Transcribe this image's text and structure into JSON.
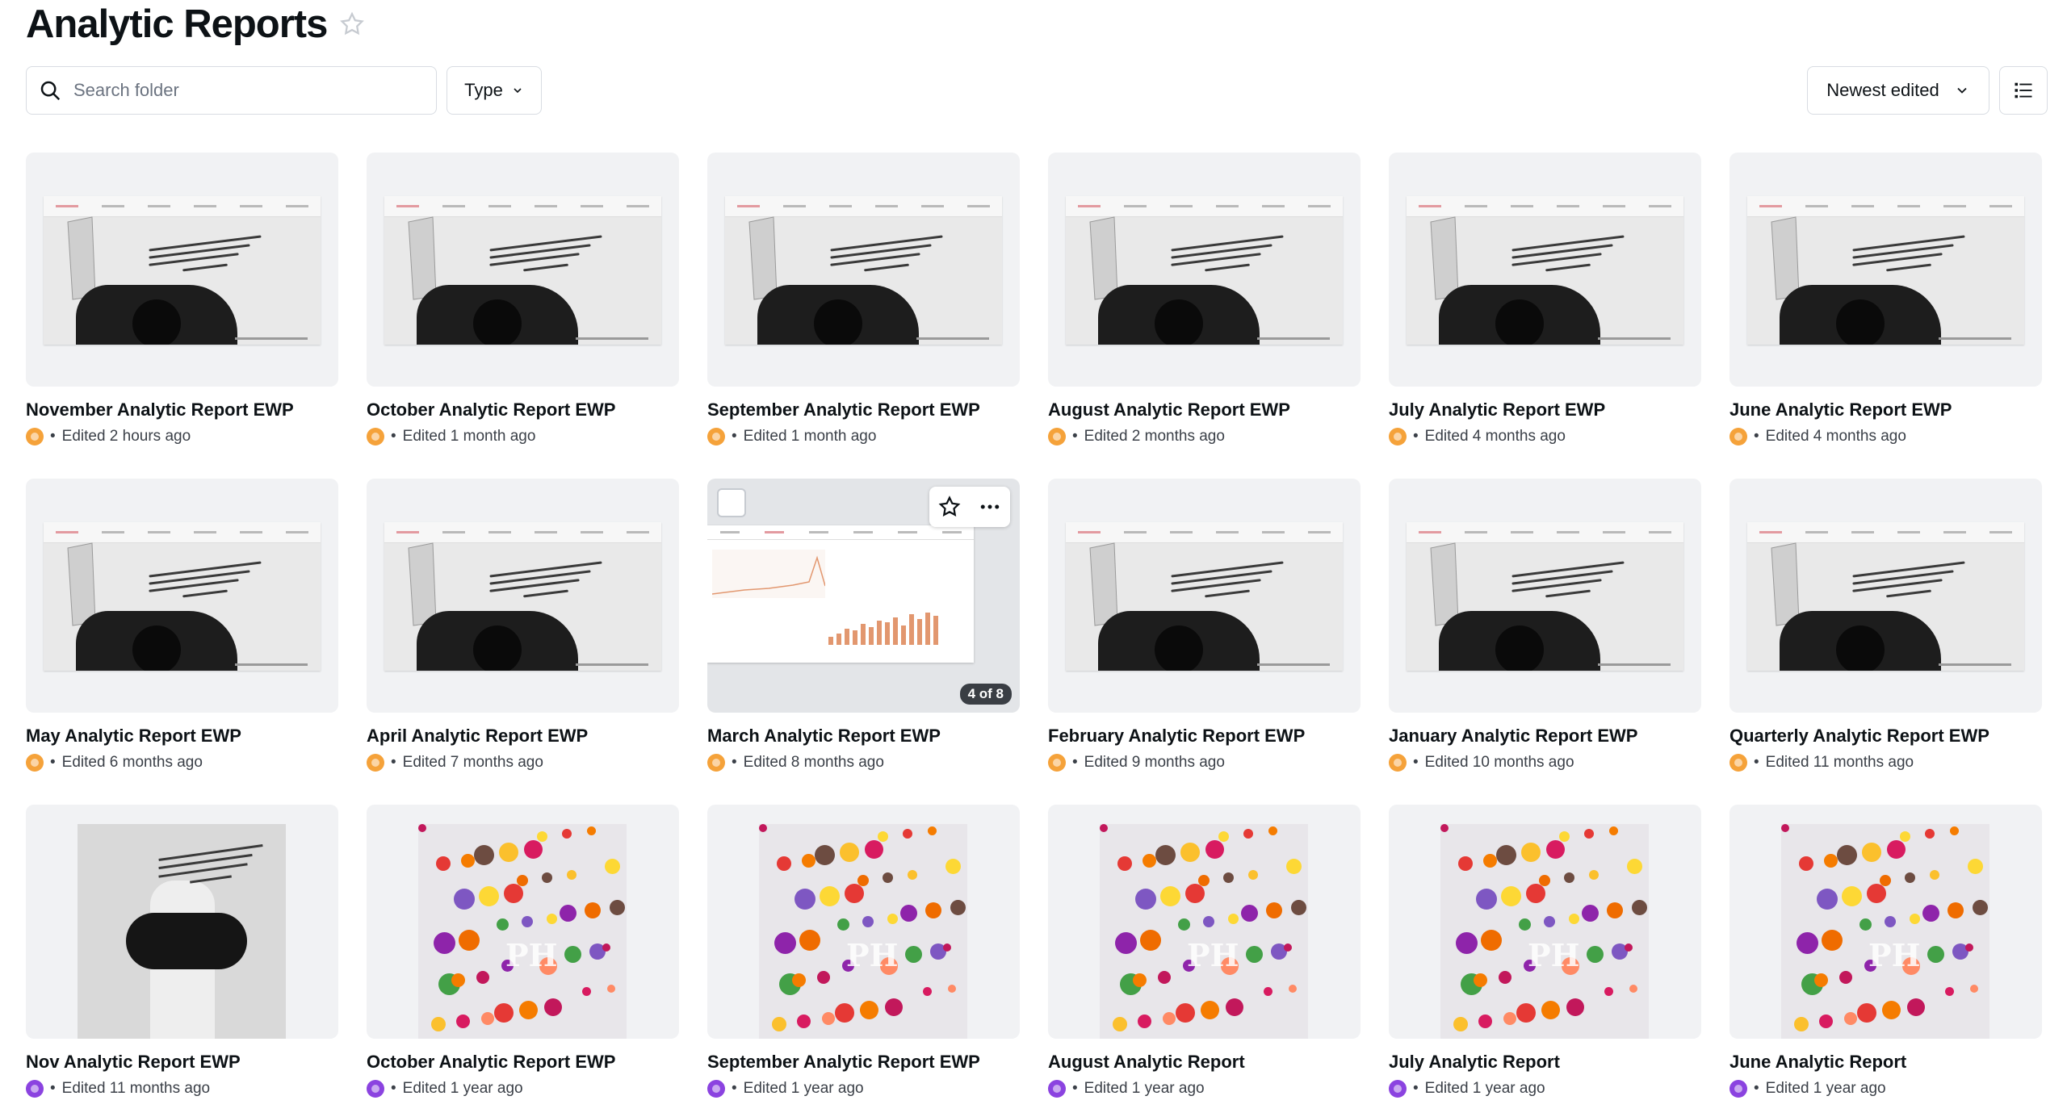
{
  "page": {
    "title": "Analytic Reports"
  },
  "toolbar": {
    "search_placeholder": "Search folder",
    "type_label": "Type",
    "sort_label": "Newest edited"
  },
  "items": [
    {
      "title": "November Analytic Report EWP",
      "edited": "Edited 2 hours ago",
      "owner_color": "orange",
      "thumb": "slide"
    },
    {
      "title": "October Analytic Report EWP",
      "edited": "Edited 1 month ago",
      "owner_color": "orange",
      "thumb": "slide"
    },
    {
      "title": "September Analytic Report EWP",
      "edited": "Edited 1 month ago",
      "owner_color": "orange",
      "thumb": "slide"
    },
    {
      "title": "August Analytic Report EWP",
      "edited": "Edited 2 months ago",
      "owner_color": "orange",
      "thumb": "slide"
    },
    {
      "title": "July Analytic Report EWP",
      "edited": "Edited 4 months ago",
      "owner_color": "orange",
      "thumb": "slide"
    },
    {
      "title": "June Analytic Report EWP",
      "edited": "Edited 4 months ago",
      "owner_color": "orange",
      "thumb": "slide"
    },
    {
      "title": "May Analytic Report EWP",
      "edited": "Edited 6 months ago",
      "owner_color": "orange",
      "thumb": "slide"
    },
    {
      "title": "April Analytic Report EWP",
      "edited": "Edited 7 months ago",
      "owner_color": "orange",
      "thumb": "slide"
    },
    {
      "title": "March Analytic Report EWP",
      "edited": "Edited 8 months ago",
      "owner_color": "orange",
      "thumb": "dashboard",
      "page_badge": "4 of 8"
    },
    {
      "title": "February Analytic Report EWP",
      "edited": "Edited 9 months ago",
      "owner_color": "orange",
      "thumb": "slide"
    },
    {
      "title": "January Analytic Report EWP",
      "edited": "Edited 10 months ago",
      "owner_color": "orange",
      "thumb": "slide"
    },
    {
      "title": "Quarterly Analytic Report EWP",
      "edited": "Edited 11 months ago",
      "owner_color": "orange",
      "thumb": "slide"
    },
    {
      "title": "Nov Analytic Report EWP",
      "edited": "Edited 11 months ago",
      "owner_color": "purple",
      "thumb": "portrait"
    },
    {
      "title": "October Analytic Report EWP",
      "edited": "Edited 1 year ago",
      "owner_color": "purple",
      "thumb": "flowers"
    },
    {
      "title": "September Analytic Report EWP",
      "edited": "Edited 1 year ago",
      "owner_color": "purple",
      "thumb": "flowers"
    },
    {
      "title": "August Analytic Report",
      "edited": "Edited 1 year ago",
      "owner_color": "purple",
      "thumb": "flowers"
    },
    {
      "title": "July Analytic Report",
      "edited": "Edited 1 year ago",
      "owner_color": "purple",
      "thumb": "flowers"
    },
    {
      "title": "June Analytic Report",
      "edited": "Edited 1 year ago",
      "owner_color": "purple",
      "thumb": "flowers"
    }
  ],
  "colors": {
    "orange": "#f5a23a",
    "purple": "#8b43e0",
    "accent_pink": "#e39aa0"
  },
  "icons": {
    "star": "star-outline-icon",
    "search": "search-icon",
    "chevron": "chevron-down-icon",
    "list": "list-view-icon",
    "more": "more-horizontal-icon"
  }
}
